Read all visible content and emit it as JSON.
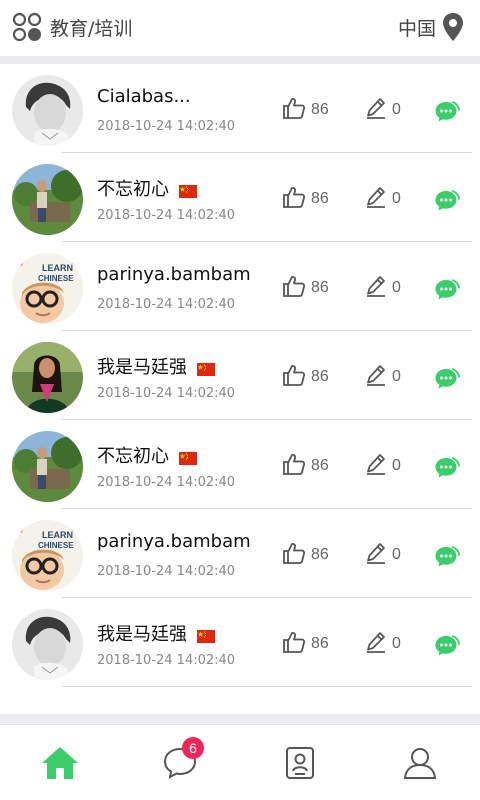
{
  "header": {
    "category_label": "教育/培训",
    "location_label": "中国",
    "category_icon": "grid-circles-icon",
    "location_icon": "location-pin-icon"
  },
  "colors": {
    "accent_green": "#3ccd6b",
    "icon_gray": "#555555",
    "badge_red": "#f0255a"
  },
  "list": {
    "items": [
      {
        "name": "Cialabas...",
        "flag": "",
        "date": "2018-10-24 14:02:40",
        "likes": "86",
        "edits": "0",
        "avatar": "boy"
      },
      {
        "name": "不忘初心",
        "flag": "cn",
        "date": "2018-10-24 14:02:40",
        "likes": "86",
        "edits": "0",
        "avatar": "outdoor"
      },
      {
        "name": "parinya.bambam",
        "flag": "",
        "date": "2018-10-24 14:02:40",
        "likes": "86",
        "edits": "0",
        "avatar": "kid"
      },
      {
        "name": "我是马廷强",
        "flag": "cn",
        "date": "2018-10-24 14:02:40",
        "likes": "86",
        "edits": "0",
        "avatar": "woman"
      },
      {
        "name": "不忘初心",
        "flag": "cn",
        "date": "2018-10-24 14:02:40",
        "likes": "86",
        "edits": "0",
        "avatar": "outdoor"
      },
      {
        "name": "parinya.bambam",
        "flag": "",
        "date": "2018-10-24 14:02:40",
        "likes": "86",
        "edits": "0",
        "avatar": "kid"
      },
      {
        "name": "我是马廷强",
        "flag": "cn",
        "date": "2018-10-24 14:02:40",
        "likes": "86",
        "edits": "0",
        "avatar": "boy"
      }
    ]
  },
  "tabbar": {
    "tabs": [
      {
        "icon": "home-icon",
        "active": true
      },
      {
        "icon": "message-bubble-icon",
        "badge": "6"
      },
      {
        "icon": "contacts-card-icon"
      },
      {
        "icon": "user-profile-icon"
      }
    ]
  }
}
